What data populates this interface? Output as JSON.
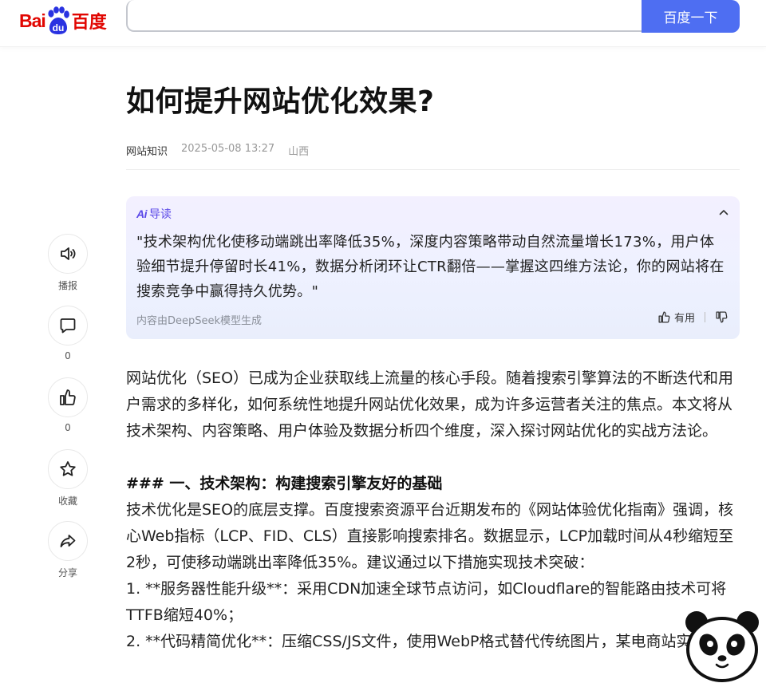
{
  "header": {
    "logo_left": "Bai",
    "logo_right": "百度",
    "search_value": "",
    "search_button": "百度一下"
  },
  "article": {
    "title": "如何提升网站优化效果?",
    "category": "网站知识",
    "datetime": "2025-05-08 13:27",
    "location": "山西"
  },
  "ai_summary": {
    "logo": "Ai",
    "label": "导读",
    "text": "\"技术架构优化使移动端跳出率降低35%，深度内容策略带动自然流量增长173%，用户体验细节提升停留时长41%，数据分析闭环让CTR翻倍——掌握这四维方法论，你的网站将在搜索竞争中赢得持久优势。\"",
    "footer": "内容由DeepSeek模型生成",
    "useful_label": "有用"
  },
  "sidebar": {
    "broadcast_label": "播报",
    "comment_count": "0",
    "like_count": "0",
    "favorite_label": "收藏",
    "share_label": "分享"
  },
  "body": {
    "p1": "网站优化（SEO）已成为企业获取线上流量的核心手段。随着搜索引擎算法的不断迭代和用户需求的多样化，如何系统性地提升网站优化效果，成为许多运营者关注的焦点。本文将从技术架构、内容策略、用户体验及数据分析四个维度，深入探讨网站优化的实战方法论。",
    "h1": "### 一、技术架构：构建搜索引擎友好的基础",
    "p2": "技术优化是SEO的底层支撑。百度搜索资源平台近期发布的《网站体验优化指南》强调，核心Web指标（LCP、FID、CLS）直接影响搜索排名。数据显示，LCP加载时间从4秒缩短至2秒，可使移动端跳出率降低35%。建议通过以下措施实现技术突破：",
    "li1": "1. **服务器性能升级**：采用CDN加速全球节点访问，如Cloudflare的智能路由技术可将TTFB缩短40%；",
    "li2": "2. **代码精简优化**：压缩CSS/JS文件，使用WebP格式替代传统图片，某电商站实测比"
  },
  "colors": {
    "brand_red": "#e10601",
    "brand_blue": "#4e6ef2",
    "ai_purple": "#5a47e8"
  }
}
